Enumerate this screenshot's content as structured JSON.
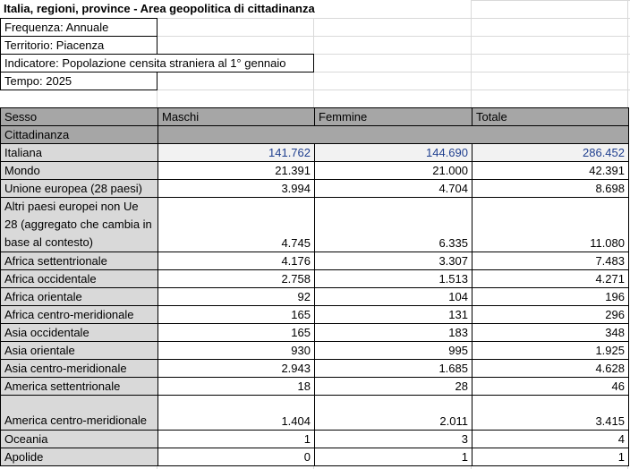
{
  "title": "Italia, regioni, province - Area geopolitica di cittadinanza",
  "meta": {
    "frequenza": "Frequenza: Annuale",
    "territorio": "Territorio: Piacenza",
    "indicatore": "Indicatore: Popolazione censita straniera al 1° gennaio",
    "tempo": "Tempo: 2025"
  },
  "table": {
    "header_label": "Sesso",
    "columns": [
      "Maschi",
      "Femmine",
      "Totale"
    ],
    "subheader_label": "Cittadinanza",
    "rows": [
      {
        "label": "Italiana",
        "values": [
          "141.762",
          "144.690",
          "286.452"
        ]
      },
      {
        "label": "Mondo",
        "values": [
          "21.391",
          "21.000",
          "42.391"
        ]
      },
      {
        "label": "Unione europea (28 paesi)",
        "values": [
          "3.994",
          "4.704",
          "8.698"
        ]
      },
      {
        "label": "Altri paesi europei non Ue 28 (aggregato che cambia in base al contesto)",
        "values": [
          "4.745",
          "6.335",
          "11.080"
        ]
      },
      {
        "label": "Africa settentrionale",
        "values": [
          "4.176",
          "3.307",
          "7.483"
        ]
      },
      {
        "label": "Africa occidentale",
        "values": [
          "2.758",
          "1.513",
          "4.271"
        ]
      },
      {
        "label": "Africa orientale",
        "values": [
          "92",
          "104",
          "196"
        ]
      },
      {
        "label": "Africa centro-meridionale",
        "values": [
          "165",
          "131",
          "296"
        ]
      },
      {
        "label": "Asia occidentale",
        "values": [
          "165",
          "183",
          "348"
        ]
      },
      {
        "label": "Asia orientale",
        "values": [
          "930",
          "995",
          "1.925"
        ]
      },
      {
        "label": "Asia centro-meridionale",
        "values": [
          "2.943",
          "1.685",
          "4.628"
        ]
      },
      {
        "label": "America settentrionale",
        "values": [
          "18",
          "28",
          "46"
        ]
      },
      {
        "label": "America centro-meridionale",
        "values": [
          "1.404",
          "2.011",
          "3.415"
        ]
      },
      {
        "label": "Oceania",
        "values": [
          "1",
          "3",
          "4"
        ]
      },
      {
        "label": "Apolide",
        "values": [
          "0",
          "1",
          "1"
        ]
      }
    ]
  }
}
